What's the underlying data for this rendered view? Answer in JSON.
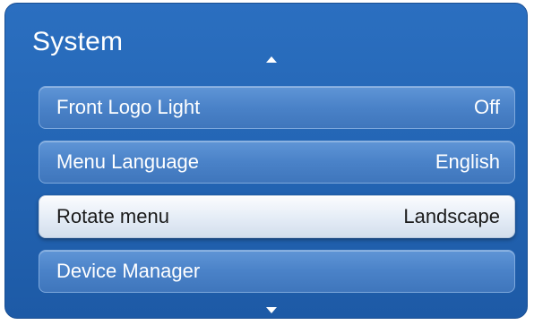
{
  "menu": {
    "title": "System",
    "items": [
      {
        "label": "Front Logo Light",
        "value": "Off"
      },
      {
        "label": "Menu Language",
        "value": "English"
      },
      {
        "label": "Rotate menu",
        "value": "Landscape",
        "selected": true
      },
      {
        "label": "Device Manager",
        "value": ""
      }
    ],
    "scroll_up_icon": "triangle-up",
    "scroll_down_icon": "triangle-down"
  },
  "colors": {
    "panel_blue": "#2466b5",
    "item_blue": "#4a82c8",
    "selected_item": "#e4ecf6",
    "text_light": "#ffffff",
    "text_dark": "#1a1a1a"
  }
}
